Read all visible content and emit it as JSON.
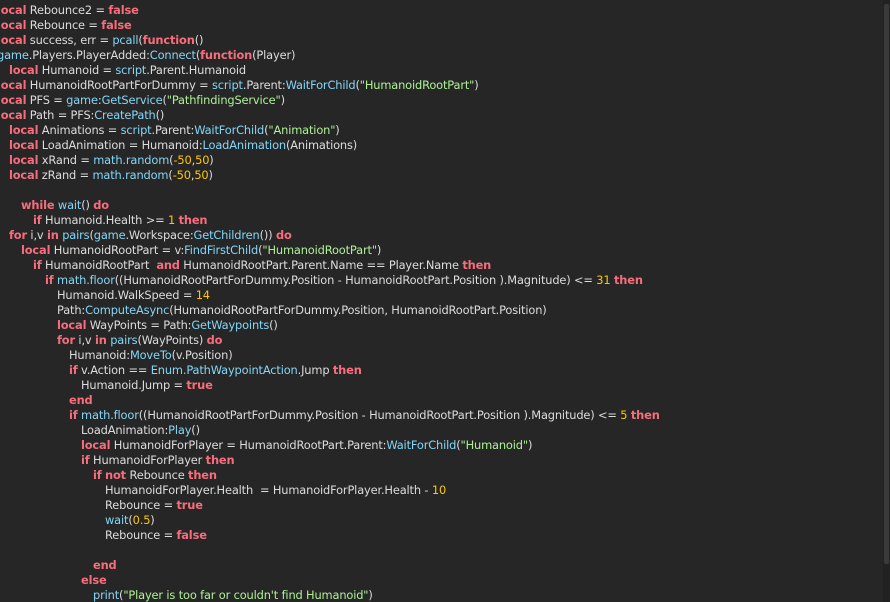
{
  "editor": {
    "lines": [
      {
        "indent": 0,
        "tokens": [
          [
            "kw",
            "local"
          ],
          [
            "tx",
            " Rebounce2 = "
          ],
          [
            "kw",
            "false"
          ]
        ]
      },
      {
        "indent": 0,
        "tokens": [
          [
            "kw",
            "local"
          ],
          [
            "tx",
            " Rebounce = "
          ],
          [
            "kw",
            "false"
          ]
        ]
      },
      {
        "indent": 0,
        "tokens": [
          [
            "kw",
            "local"
          ],
          [
            "tx",
            " success, err = "
          ],
          [
            "bi",
            "pcall"
          ],
          [
            "tx",
            "("
          ],
          [
            "kw",
            "function"
          ],
          [
            "tx",
            "()"
          ]
        ]
      },
      {
        "indent": 0,
        "tokens": [
          [
            "bi",
            "game"
          ],
          [
            "tx",
            ".Players.PlayerAdded:"
          ],
          [
            "bi",
            "Connect"
          ],
          [
            "tx",
            "("
          ],
          [
            "kw",
            "function"
          ],
          [
            "tx",
            "(Player)"
          ]
        ]
      },
      {
        "indent": 1,
        "tokens": [
          [
            "kw",
            "local"
          ],
          [
            "tx",
            " Humanoid = "
          ],
          [
            "bi",
            "script"
          ],
          [
            "tx",
            ".Parent.Humanoid"
          ]
        ]
      },
      {
        "indent": 0,
        "tokens": [
          [
            "kw",
            "local"
          ],
          [
            "tx",
            " HumanoidRootPartForDummy = "
          ],
          [
            "bi",
            "script"
          ],
          [
            "tx",
            ".Parent:"
          ],
          [
            "bi",
            "WaitForChild"
          ],
          [
            "tx",
            "("
          ],
          [
            "st",
            "\"HumanoidRootPart\""
          ],
          [
            "tx",
            ")"
          ]
        ]
      },
      {
        "indent": 0,
        "tokens": [
          [
            "kw",
            "local"
          ],
          [
            "tx",
            " PFS = "
          ],
          [
            "bi",
            "game"
          ],
          [
            "tx",
            ":"
          ],
          [
            "bi",
            "GetService"
          ],
          [
            "tx",
            "("
          ],
          [
            "st",
            "\"PathfindingService\""
          ],
          [
            "tx",
            ")"
          ]
        ]
      },
      {
        "indent": 0,
        "tokens": [
          [
            "kw",
            "local"
          ],
          [
            "tx",
            " Path = PFS:"
          ],
          [
            "bi",
            "CreatePath"
          ],
          [
            "tx",
            "()"
          ]
        ]
      },
      {
        "indent": 1,
        "tokens": [
          [
            "kw",
            "local"
          ],
          [
            "tx",
            " Animations = "
          ],
          [
            "bi",
            "script"
          ],
          [
            "tx",
            ".Parent:"
          ],
          [
            "bi",
            "WaitForChild"
          ],
          [
            "tx",
            "("
          ],
          [
            "st",
            "\"Animation\""
          ],
          [
            "tx",
            ")"
          ]
        ]
      },
      {
        "indent": 1,
        "tokens": [
          [
            "kw",
            "local"
          ],
          [
            "tx",
            " LoadAnimation = Humanoid:"
          ],
          [
            "bi",
            "LoadAnimation"
          ],
          [
            "tx",
            "(Animations)"
          ]
        ]
      },
      {
        "indent": 1,
        "tokens": [
          [
            "kw",
            "local"
          ],
          [
            "tx",
            " xRand = "
          ],
          [
            "bi",
            "math.random"
          ],
          [
            "tx",
            "("
          ],
          [
            "nm",
            "-50"
          ],
          [
            "tx",
            ","
          ],
          [
            "nm",
            "50"
          ],
          [
            "tx",
            ")"
          ]
        ]
      },
      {
        "indent": 1,
        "tokens": [
          [
            "kw",
            "local"
          ],
          [
            "tx",
            " zRand = "
          ],
          [
            "bi",
            "math.random"
          ],
          [
            "tx",
            "("
          ],
          [
            "nm",
            "-50"
          ],
          [
            "tx",
            ","
          ],
          [
            "nm",
            "50"
          ],
          [
            "tx",
            ")"
          ]
        ]
      },
      {
        "indent": 0,
        "tokens": []
      },
      {
        "indent": 2,
        "tokens": [
          [
            "kw",
            "while"
          ],
          [
            "tx",
            " "
          ],
          [
            "bi",
            "wait"
          ],
          [
            "tx",
            "() "
          ],
          [
            "kw",
            "do"
          ]
        ]
      },
      {
        "indent": 3,
        "tokens": [
          [
            "kw",
            "if"
          ],
          [
            "tx",
            " Humanoid.Health >= "
          ],
          [
            "nm",
            "1"
          ],
          [
            "tx",
            " "
          ],
          [
            "kw",
            "then"
          ]
        ]
      },
      {
        "indent": 1,
        "tokens": [
          [
            "kw",
            "for"
          ],
          [
            "tx",
            " i,v "
          ],
          [
            "kw",
            "in"
          ],
          [
            "tx",
            " "
          ],
          [
            "bi",
            "pairs"
          ],
          [
            "tx",
            "("
          ],
          [
            "bi",
            "game"
          ],
          [
            "tx",
            ".Workspace:"
          ],
          [
            "bi",
            "GetChildren"
          ],
          [
            "tx",
            "()) "
          ],
          [
            "kw",
            "do"
          ]
        ]
      },
      {
        "indent": 2,
        "tokens": [
          [
            "kw",
            "local"
          ],
          [
            "tx",
            " HumanoidRootPart = v:"
          ],
          [
            "bi",
            "FindFirstChild"
          ],
          [
            "tx",
            "("
          ],
          [
            "st",
            "\"HumanoidRootPart\""
          ],
          [
            "tx",
            ")"
          ]
        ]
      },
      {
        "indent": 3,
        "tokens": [
          [
            "kw",
            "if"
          ],
          [
            "tx",
            " HumanoidRootPart  "
          ],
          [
            "kw",
            "and"
          ],
          [
            "tx",
            " HumanoidRootPart.Parent.Name == Player.Name "
          ],
          [
            "kw",
            "then"
          ]
        ]
      },
      {
        "indent": 4,
        "tokens": [
          [
            "kw",
            "if"
          ],
          [
            "tx",
            " "
          ],
          [
            "bi",
            "math.floor"
          ],
          [
            "tx",
            "((HumanoidRootPartForDummy.Position - HumanoidRootPart.Position ).Magnitude) <= "
          ],
          [
            "nm",
            "31"
          ],
          [
            "tx",
            " "
          ],
          [
            "kw",
            "then"
          ]
        ]
      },
      {
        "indent": 5,
        "tokens": [
          [
            "tx",
            "Humanoid.WalkSpeed = "
          ],
          [
            "nm",
            "14"
          ]
        ]
      },
      {
        "indent": 5,
        "tokens": [
          [
            "tx",
            "Path:"
          ],
          [
            "bi",
            "ComputeAsync"
          ],
          [
            "tx",
            "(HumanoidRootPartForDummy.Position, HumanoidRootPart.Position)"
          ]
        ]
      },
      {
        "indent": 5,
        "tokens": [
          [
            "kw",
            "local"
          ],
          [
            "tx",
            " WayPoints = Path:"
          ],
          [
            "bi",
            "GetWaypoints"
          ],
          [
            "tx",
            "()"
          ]
        ]
      },
      {
        "indent": 5,
        "tokens": [
          [
            "kw",
            "for"
          ],
          [
            "tx",
            " i,v "
          ],
          [
            "kw",
            "in"
          ],
          [
            "tx",
            " "
          ],
          [
            "bi",
            "pairs"
          ],
          [
            "tx",
            "(WayPoints) "
          ],
          [
            "kw",
            "do"
          ]
        ]
      },
      {
        "indent": 6,
        "tokens": [
          [
            "tx",
            "Humanoid:"
          ],
          [
            "bi",
            "MoveTo"
          ],
          [
            "tx",
            "(v.Position)"
          ]
        ]
      },
      {
        "indent": 6,
        "tokens": [
          [
            "kw",
            "if"
          ],
          [
            "tx",
            " v.Action == "
          ],
          [
            "bi",
            "Enum.PathWaypointAction"
          ],
          [
            "tx",
            ".Jump "
          ],
          [
            "kw",
            "then"
          ]
        ]
      },
      {
        "indent": 7,
        "tokens": [
          [
            "tx",
            "Humanoid.Jump = "
          ],
          [
            "kw",
            "true"
          ]
        ]
      },
      {
        "indent": 6,
        "tokens": [
          [
            "kw",
            "end"
          ]
        ]
      },
      {
        "indent": 6,
        "tokens": [
          [
            "kw",
            "if"
          ],
          [
            "tx",
            " "
          ],
          [
            "bi",
            "math.floor"
          ],
          [
            "tx",
            "((HumanoidRootPartForDummy.Position - HumanoidRootPart.Position ).Magnitude) <= "
          ],
          [
            "nm",
            "5"
          ],
          [
            "tx",
            " "
          ],
          [
            "kw",
            "then"
          ]
        ]
      },
      {
        "indent": 7,
        "tokens": [
          [
            "tx",
            "LoadAnimation:"
          ],
          [
            "bi",
            "Play"
          ],
          [
            "tx",
            "()"
          ]
        ]
      },
      {
        "indent": 7,
        "tokens": [
          [
            "kw",
            "local"
          ],
          [
            "tx",
            " HumanoidForPlayer = HumanoidRootPart.Parent:"
          ],
          [
            "bi",
            "WaitForChild"
          ],
          [
            "tx",
            "("
          ],
          [
            "st",
            "\"Humanoid\""
          ],
          [
            "tx",
            ")"
          ]
        ]
      },
      {
        "indent": 7,
        "tokens": [
          [
            "kw",
            "if"
          ],
          [
            "tx",
            " HumanoidForPlayer "
          ],
          [
            "kw",
            "then"
          ]
        ]
      },
      {
        "indent": 8,
        "tokens": [
          [
            "kw",
            "if"
          ],
          [
            "tx",
            " "
          ],
          [
            "kw",
            "not"
          ],
          [
            "tx",
            " Rebounce "
          ],
          [
            "kw",
            "then"
          ]
        ]
      },
      {
        "indent": 9,
        "tokens": [
          [
            "tx",
            "HumanoidForPlayer.Health  = HumanoidForPlayer.Health - "
          ],
          [
            "nm",
            "10"
          ]
        ]
      },
      {
        "indent": 9,
        "tokens": [
          [
            "tx",
            "Rebounce = "
          ],
          [
            "kw",
            "true"
          ]
        ]
      },
      {
        "indent": 9,
        "tokens": [
          [
            "bi",
            "wait"
          ],
          [
            "tx",
            "("
          ],
          [
            "nm",
            "0.5"
          ],
          [
            "tx",
            ")"
          ]
        ]
      },
      {
        "indent": 9,
        "tokens": [
          [
            "tx",
            "Rebounce = "
          ],
          [
            "kw",
            "false"
          ]
        ]
      },
      {
        "indent": 0,
        "tokens": []
      },
      {
        "indent": 8,
        "tokens": [
          [
            "kw",
            "end"
          ]
        ]
      },
      {
        "indent": 7,
        "tokens": [
          [
            "kw",
            "else"
          ]
        ]
      },
      {
        "indent": 8,
        "tokens": [
          [
            "bi",
            "print"
          ],
          [
            "tx",
            "("
          ],
          [
            "st",
            "\"Player is too far or couldn't find Humanoid\""
          ],
          [
            "tx",
            ")"
          ]
        ]
      }
    ]
  },
  "colors": {
    "background": "#262626",
    "keyword": "#f86d7c",
    "builtin": "#84d6f7",
    "string": "#adf195",
    "number": "#ffc600",
    "text": "#dcdcdc"
  }
}
